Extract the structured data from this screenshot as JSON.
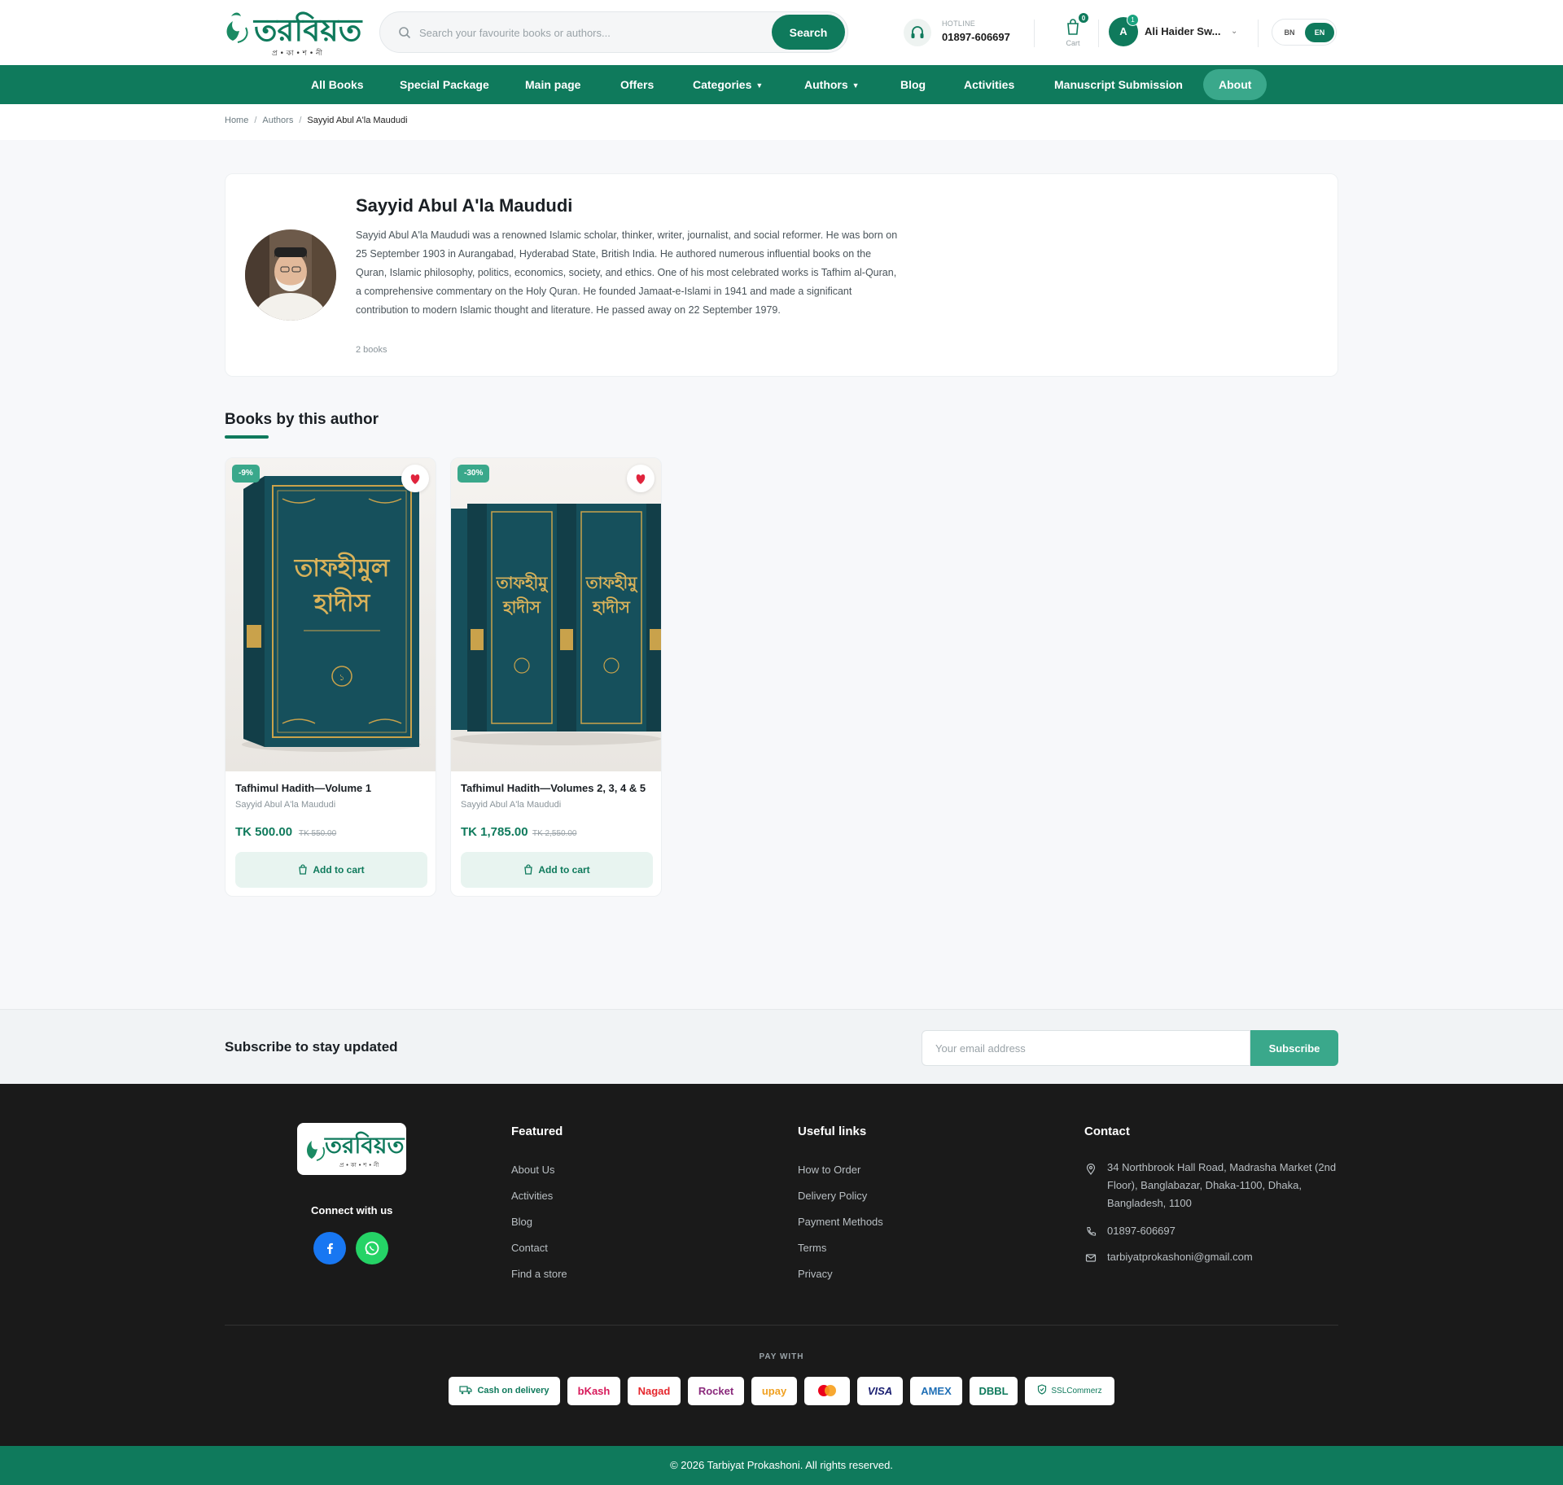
{
  "header": {
    "logo_text": "তরবিয়ত",
    "logo_sub": "প্র • কা • শ • নী",
    "search_placeholder": "Search your favourite books or authors...",
    "search_button": "Search",
    "hotline_label": "HOTLINE",
    "hotline_number": "01897-606697",
    "cart_label": "Cart",
    "cart_count": "0",
    "user_initial": "A",
    "user_badge": "1",
    "user_name": "Ali Haider Sw...",
    "lang_bn": "BN",
    "lang_en": "EN",
    "accent_color": "#0f7a5c"
  },
  "nav": {
    "items": [
      {
        "label": "All Books"
      },
      {
        "label": "Special Package"
      },
      {
        "label": "Main page"
      },
      {
        "label": "Offers"
      },
      {
        "label": "Categories"
      },
      {
        "label": "Authors"
      },
      {
        "label": "Blog"
      },
      {
        "label": "Activities"
      },
      {
        "label": "Manuscript Submission"
      },
      {
        "label": "About"
      }
    ],
    "active": "About"
  },
  "breadcrumb": {
    "home": "Home",
    "section": "Authors",
    "current": "Sayyid Abul A'la Maududi"
  },
  "author": {
    "name": "Sayyid Abul A'la Maududi",
    "bio": "Sayyid Abul A'la Maududi was a renowned Islamic scholar, thinker, writer, journalist, and social reformer. He was born on 25 September 1903 in Aurangabad, Hyderabad State, British India. He authored numerous influential books on the Quran, Islamic philosophy, politics, economics, society, and ethics. One of his most celebrated works is Tafhim al-Quran, a comprehensive commentary on the Holy Quran. He founded Jamaat-e-Islami in 1941 and made a significant contribution to modern Islamic thought and literature. He passed away on 22 September 1979.",
    "book_count": "2 books"
  },
  "books_section": {
    "title": "Books by this author",
    "books": [
      {
        "discount": "-9%",
        "cover_title": "তাফহীমুল হাদীস",
        "title": "Tafhimul Hadith—Volume 1",
        "author": "Sayyid Abul A'la Maududi",
        "price": "TK 500.00",
        "old_price": "TK 550.00",
        "button": "Add to cart"
      },
      {
        "discount": "-30%",
        "cover_title": "তাফহীমুল হাদীস",
        "title": "Tafhimul Hadith—Volumes 2, 3, 4 & 5",
        "author": "Sayyid Abul A'la Maududi",
        "price": "TK 1,785.00",
        "old_price": "TK 2,550.00",
        "button": "Add to cart"
      }
    ]
  },
  "subscribe": {
    "title": "Subscribe to stay updated",
    "placeholder": "Your email address",
    "button": "Subscribe"
  },
  "footer": {
    "connect": "Connect with us",
    "featured": {
      "title": "Featured",
      "links": [
        "About Us",
        "Activities",
        "Blog",
        "Contact",
        "Find a store"
      ]
    },
    "useful": {
      "title": "Useful links",
      "links": [
        "How to Order",
        "Delivery Policy",
        "Payment Methods",
        "Terms",
        "Privacy"
      ]
    },
    "contact": {
      "title": "Contact",
      "address": "34 Northbrook Hall Road, Madrasha Market (2nd Floor), Banglabazar, Dhaka-1100, Dhaka, Bangladesh, 1100",
      "phone": "01897-606697",
      "email": "tarbiyatprokashoni@gmail.com"
    },
    "pay_with": "PAY WITH",
    "payments": [
      "Cash on delivery",
      "bKash",
      "Nagad",
      "Rocket",
      "upay",
      "VISA",
      "AMEX",
      "DBBL",
      "SSLCommerz"
    ],
    "copyright": "© 2026 Tarbiyat Prokashoni. All rights reserved."
  }
}
